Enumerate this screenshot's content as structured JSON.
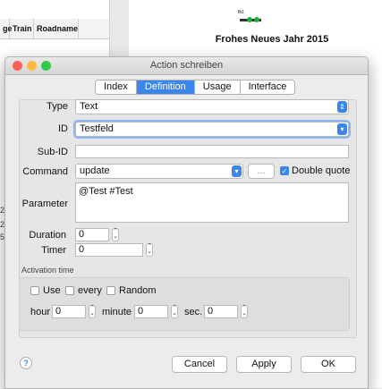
{
  "background_app": {
    "columns": [
      "ge",
      "Train",
      "Roadname"
    ],
    "plan_title": "Frohes Neues Jahr 2015",
    "plan_label": "fb1",
    "side_digits": [
      "2",
      "2",
      "5"
    ]
  },
  "dialog": {
    "title": "Action schreiben",
    "tabs": [
      {
        "label": "Index",
        "active": false
      },
      {
        "label": "Definition",
        "active": true
      },
      {
        "label": "Usage",
        "active": false
      },
      {
        "label": "Interface",
        "active": false
      }
    ],
    "type_label": "Type",
    "type_value": "Text",
    "id_label": "ID",
    "id_value": "Testfeld",
    "subid_label": "Sub-ID",
    "subid_value": "",
    "command_label": "Command",
    "command_value": "update",
    "ellipsis_label": "...",
    "double_quote_label": "Double quote",
    "double_quote_checked": true,
    "parameter_label": "Parameter",
    "parameter_value": "@Test #Test",
    "duration_label": "Duration",
    "duration_value": "0",
    "timer_label": "Timer",
    "timer_value": "0",
    "activation_label": "Activation time",
    "use_label": "Use",
    "every_label": "every",
    "random_label": "Random",
    "hour_label": "hour",
    "hour_value": "0",
    "minute_label": "minute",
    "minute_value": "0",
    "sec_label": "sec.",
    "sec_value": "0",
    "cancel_label": "Cancel",
    "apply_label": "Apply",
    "ok_label": "OK",
    "help_label": "?"
  },
  "colors": {
    "accent": "#3a86ea",
    "close": "#fc605c",
    "minimize": "#fdbc40",
    "zoom": "#34c84a",
    "signal": "#1fae3a"
  }
}
